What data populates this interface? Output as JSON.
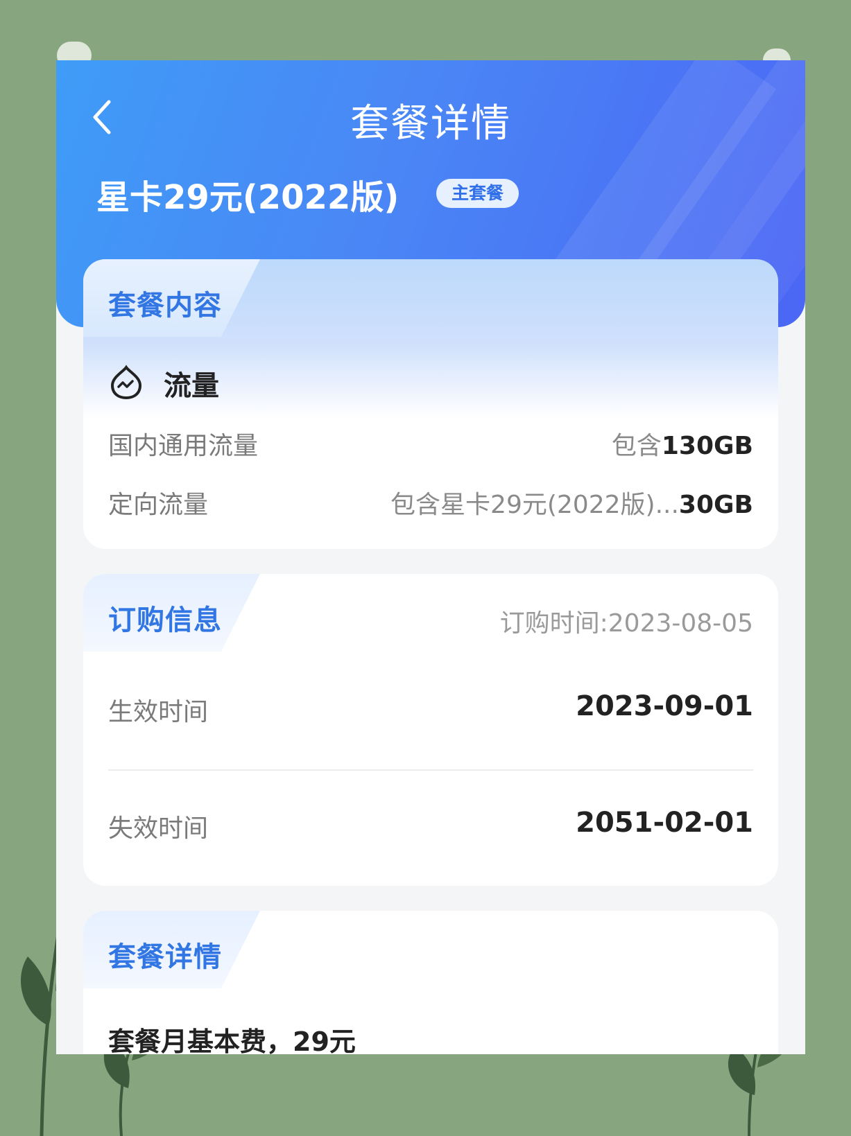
{
  "nav": {
    "back_icon": "chevron-left-icon",
    "title": "套餐详情"
  },
  "plan": {
    "name": "星卡29元(2022版)",
    "badge": "主套餐"
  },
  "content_card": {
    "heading": "套餐内容",
    "traffic_icon": "traffic-icon",
    "traffic_title": "流量",
    "rows": [
      {
        "label": "国内通用流量",
        "prefix": "包含",
        "value": "130GB"
      },
      {
        "label": "定向流量",
        "prefix": "包含星卡29元(2022版)...",
        "value": "30GB"
      }
    ]
  },
  "order_card": {
    "heading": "订购信息",
    "order_time": "订购时间:2023-08-05",
    "effective_label": "生效时间",
    "effective_value": "2023-09-01",
    "expiry_label": "失效时间",
    "expiry_value": "2051-02-01"
  },
  "detail_card": {
    "heading": "套餐详情",
    "fee_text": "套餐月基本费，29元"
  },
  "colors": {
    "header_start": "#3f9cf7",
    "header_end": "#4b66f5",
    "accent": "#3276e4",
    "background": "#87a67f"
  }
}
